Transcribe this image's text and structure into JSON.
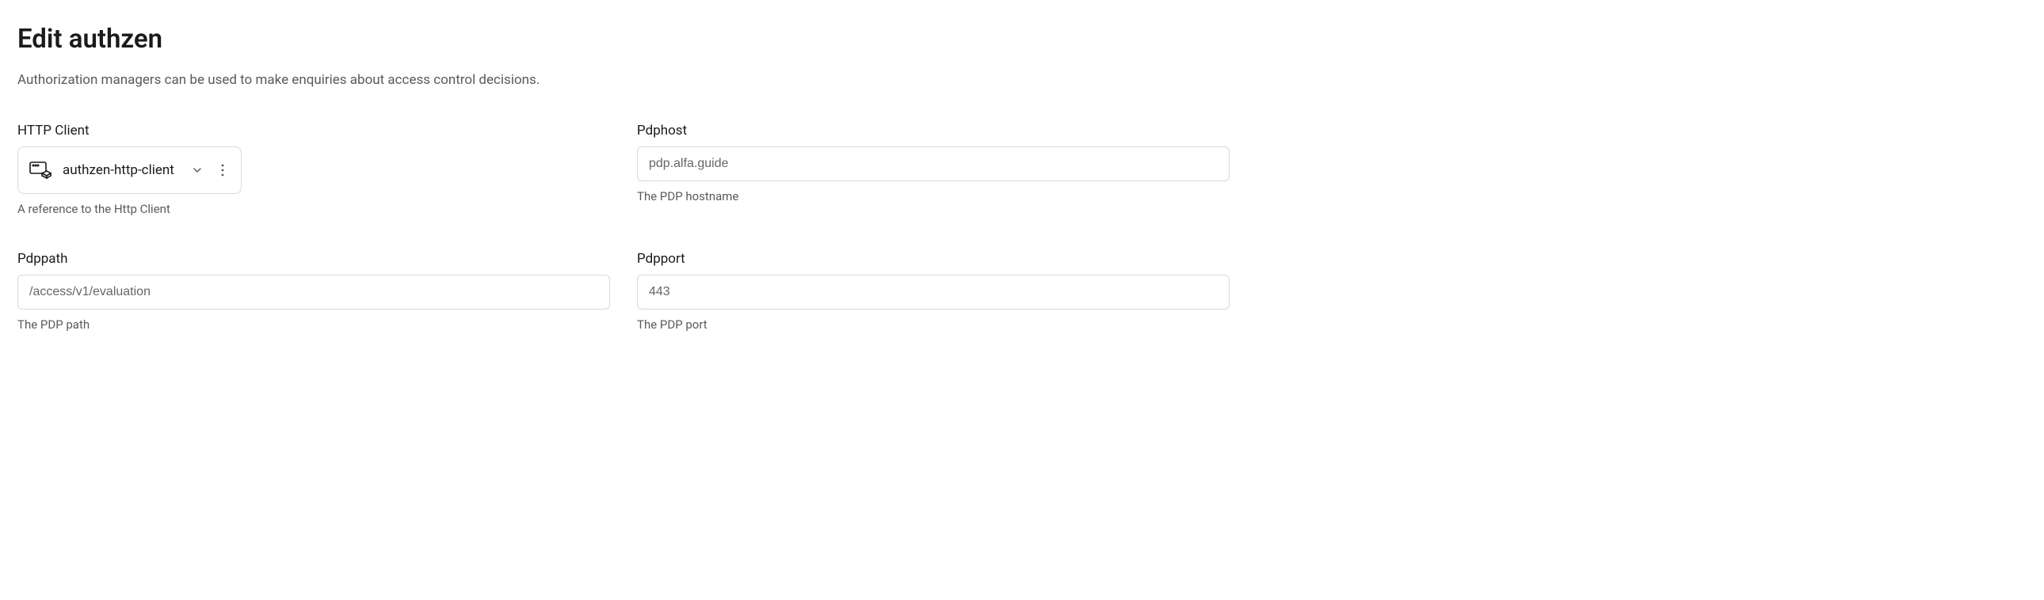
{
  "page": {
    "title": "Edit authzen",
    "description": "Authorization managers can be used to make enquiries about access control decisions."
  },
  "fields": {
    "http_client": {
      "label": "HTTP Client",
      "value": "authzen-http-client",
      "help": "A reference to the Http Client"
    },
    "pdphost": {
      "label": "Pdphost",
      "value": "pdp.alfa.guide",
      "help": "The PDP hostname"
    },
    "pdppath": {
      "label": "Pdppath",
      "value": "/access/v1/evaluation",
      "help": "The PDP path"
    },
    "pdpport": {
      "label": "Pdpport",
      "value": "443",
      "help": "The PDP port"
    }
  }
}
